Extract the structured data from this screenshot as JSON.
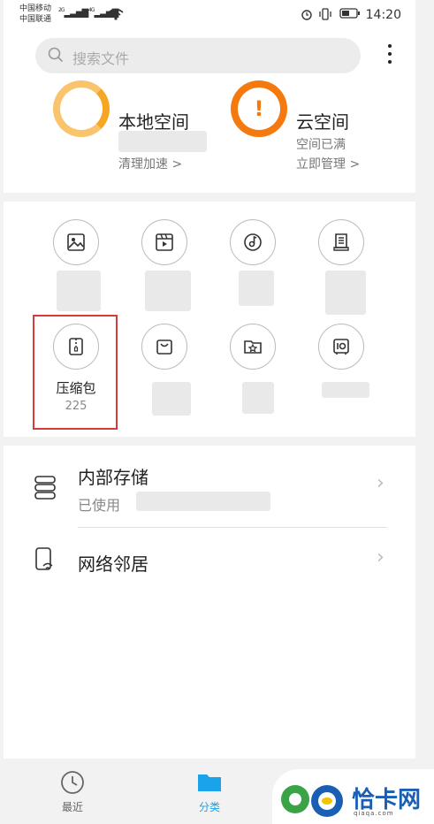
{
  "status_bar": {
    "carrier1": "中国移动",
    "carrier2": "中国联通",
    "sig1": "2G",
    "sig2": "4G",
    "time": "14:20"
  },
  "search": {
    "placeholder": "搜索文件"
  },
  "storage": {
    "local_title": "本地空间",
    "local_sub": "清理加速 >",
    "cloud_title": "云空间",
    "cloud_status": "空间已满",
    "cloud_sub": "立即管理 >",
    "cloud_icon": "!"
  },
  "categories": [
    {
      "icon": "image-icon",
      "name": "",
      "count": ""
    },
    {
      "icon": "video-icon",
      "name": "",
      "count": ""
    },
    {
      "icon": "music-icon",
      "name": "",
      "count": ""
    },
    {
      "icon": "document-icon",
      "name": "",
      "count": ""
    },
    {
      "icon": "zip-icon",
      "name": "压缩包",
      "count": "225"
    },
    {
      "icon": "bag-icon",
      "name": "",
      "count": ""
    },
    {
      "icon": "star-folder-icon",
      "name": "",
      "count": ""
    },
    {
      "icon": "safe-icon",
      "name": "",
      "count": ""
    }
  ],
  "list": {
    "internal_title": "内部存储",
    "internal_sub": "已使用",
    "network_title": "网络邻居",
    "chevron": "›"
  },
  "tabs": {
    "recent": "最近",
    "category": "分类"
  },
  "watermark": {
    "text": "恰卡网",
    "sub": "qiaqa.com"
  },
  "colors": {
    "accent": "#1aa3e8",
    "warning": "#f47a0f",
    "local_ring": "#f5a623",
    "highlight": "#d63b3b"
  }
}
